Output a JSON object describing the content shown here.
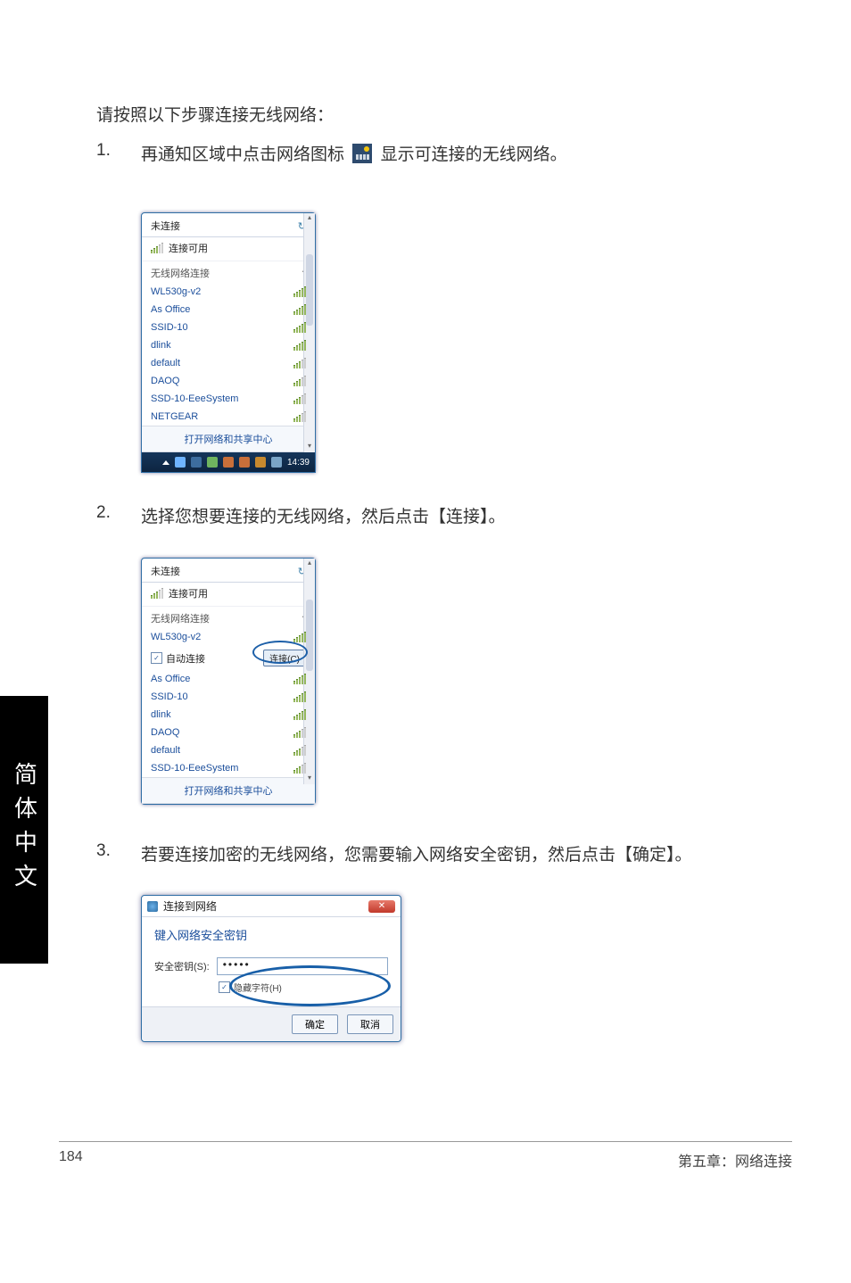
{
  "intro": "请按照以下步骤连接无线网络：",
  "steps": {
    "s1": {
      "num": "1.",
      "pre": "再通知区域中点击网络图标",
      "post": "显示可连接的无线网络。"
    },
    "s2": {
      "num": "2.",
      "text": "选择您想要连接的无线网络，然后点击【连接】。"
    },
    "s3": {
      "num": "3.",
      "text": "若要连接加密的无线网络，您需要输入网络安全密钥，然后点击【确定】。"
    }
  },
  "popup1": {
    "not_connected": "未连接",
    "connections_available": "连接可用",
    "wireless_header": "无线网络连接",
    "networks": [
      "WL530g-v2",
      "As Office",
      "SSID-10",
      "dlink",
      "default",
      "DAOQ",
      "SSD-10-EeeSystem",
      "NETGEAR"
    ],
    "open_center": "打开网络和共享中心",
    "clock": "14:39"
  },
  "popup2": {
    "not_connected": "未连接",
    "connections_available": "连接可用",
    "wireless_header": "无线网络连接",
    "selected": "WL530g-v2",
    "auto_connect": "自动连接",
    "connect_btn": "连接(C)",
    "networks": [
      "As Office",
      "SSID-10",
      "dlink",
      "DAOQ",
      "default",
      "SSD-10-EeeSystem"
    ],
    "open_center": "打开网络和共享中心"
  },
  "dialog": {
    "title": "连接到网络",
    "prompt": "键入网络安全密钥",
    "key_label": "安全密钥(S):",
    "key_value": "•••••",
    "hide_chars": "隐藏字符(H)",
    "ok": "确定",
    "cancel": "取消"
  },
  "side_tab": "简体中文",
  "footer": {
    "page": "184",
    "chapter": "第五章：网络连接"
  }
}
